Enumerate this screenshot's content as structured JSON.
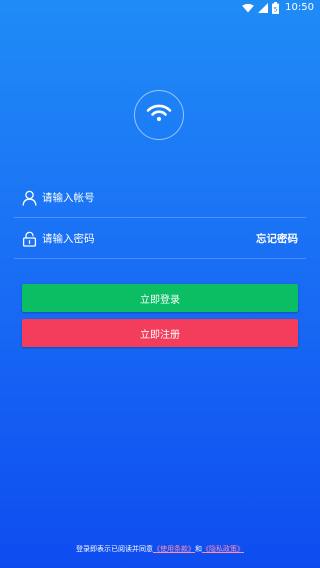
{
  "status_bar": {
    "time": "10:50",
    "battery_level": "5",
    "icons": [
      "wifi-icon",
      "signal-icon",
      "battery-icon"
    ]
  },
  "logo": {
    "icon": "wifi-icon"
  },
  "account": {
    "icon": "user-icon",
    "placeholder": "请输入帐号",
    "value": ""
  },
  "password": {
    "icon": "lock-icon",
    "placeholder": "请输入密码",
    "value": "",
    "forgot_label": "忘记密码"
  },
  "buttons": {
    "login_label": "立即登录",
    "register_label": "立即注册"
  },
  "agreement": {
    "prefix": "登录即表示已阅读并同意",
    "terms_link": "《使用条款》",
    "conjunction": "和",
    "privacy_link": "《隐私政策》"
  },
  "colors": {
    "background_top": "#1f8cf6",
    "background_bottom": "#0e4cf0",
    "login_button": "#0bbd63",
    "register_button": "#f43d5c",
    "link": "#ff8fb0"
  }
}
